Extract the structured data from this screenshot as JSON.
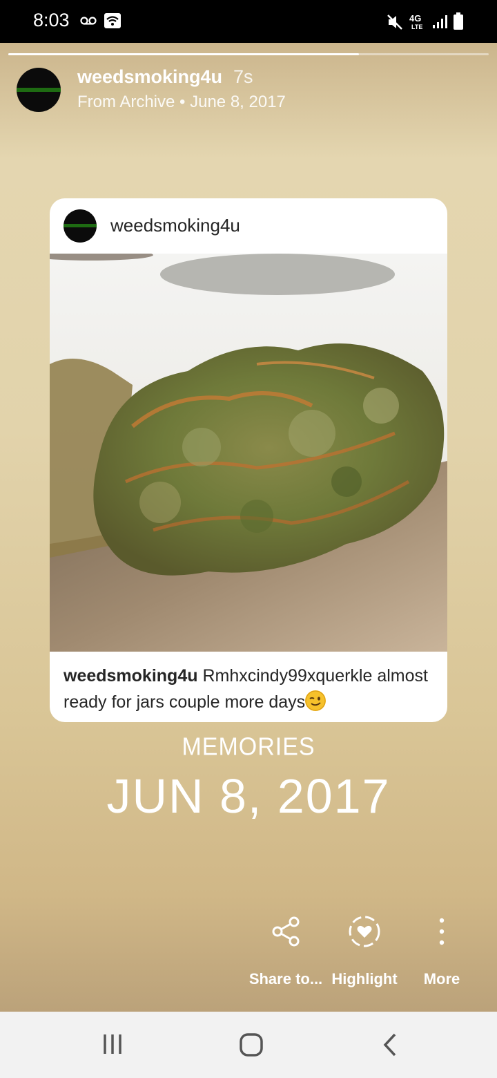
{
  "status_bar": {
    "time": "8:03",
    "icons": [
      "voicemail-icon",
      "wifi-icon",
      "mute-icon",
      "4g-lte-icon",
      "signal-icon",
      "battery-icon"
    ],
    "network_label": "4G"
  },
  "story": {
    "progress_fraction": 0.73,
    "username": "weedsmoking4u",
    "time_ago": "7s",
    "subtitle": "From Archive • June 8, 2017",
    "card": {
      "username": "weedsmoking4u",
      "caption_user": "weedsmoking4u",
      "caption_text": " Rmhxcindy99xquerkle almost ready for jars couple more days"
    },
    "memories_label": "MEMORIES",
    "memories_date": "JUN 8, 2017"
  },
  "actions": [
    {
      "icon": "share-icon",
      "label": "Share to..."
    },
    {
      "icon": "highlight-icon",
      "label": "Highlight"
    },
    {
      "icon": "more-icon",
      "label": "More"
    }
  ],
  "nav_bar": {
    "icons": [
      "recent-apps-icon",
      "home-icon",
      "back-icon"
    ]
  },
  "colors": {
    "story_bg": "#e2d3ab",
    "text": "#262626"
  }
}
